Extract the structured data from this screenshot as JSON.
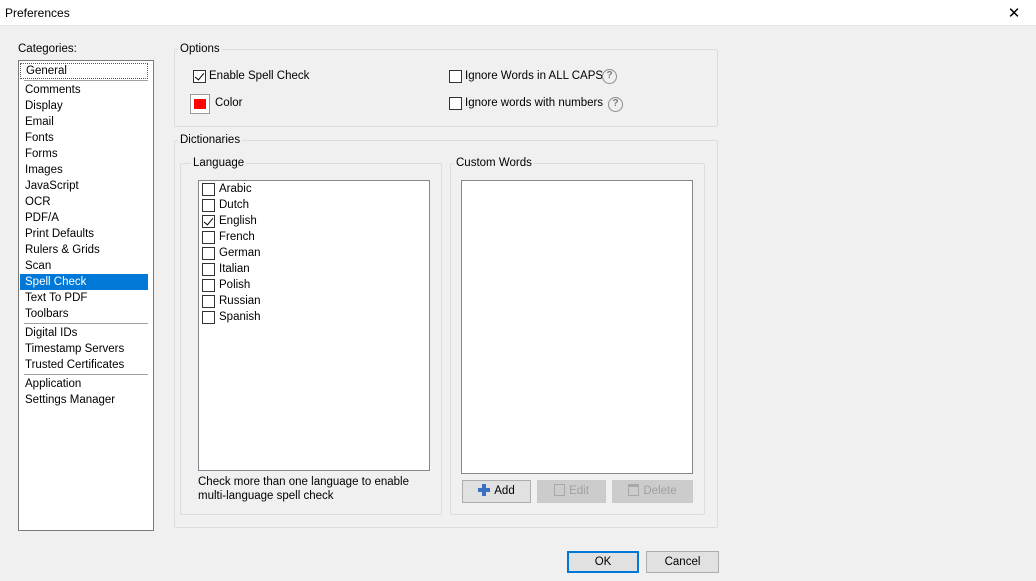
{
  "window": {
    "title": "Preferences",
    "close_glyph": "✕"
  },
  "categories": {
    "label": "Categories:",
    "groups": [
      [
        "General"
      ],
      [
        "Comments",
        "Display",
        "Email",
        "Fonts",
        "Forms",
        "Images",
        "JavaScript",
        "OCR",
        "PDF/A",
        "Print Defaults",
        "Rulers & Grids",
        "Scan",
        "Spell Check",
        "Text To PDF",
        "Toolbars"
      ],
      [
        "Digital IDs",
        "Timestamp Servers",
        "Trusted Certificates"
      ],
      [
        "Application",
        "Settings Manager"
      ]
    ],
    "selected": "Spell Check"
  },
  "options": {
    "label": "Options",
    "enable_spell_check": {
      "label": "Enable Spell Check",
      "checked": true
    },
    "color": {
      "label": "Color",
      "value": "#ff0000"
    },
    "ignore_caps": {
      "label": "Ignore Words in ALL CAPS",
      "checked": false
    },
    "ignore_numbers": {
      "label": "Ignore words with numbers",
      "checked": false
    },
    "help_glyph": "?"
  },
  "dictionaries": {
    "label": "Dictionaries",
    "language": {
      "label": "Language",
      "items": [
        {
          "name": "Arabic",
          "checked": false
        },
        {
          "name": "Dutch",
          "checked": false
        },
        {
          "name": "English",
          "checked": true
        },
        {
          "name": "French",
          "checked": false
        },
        {
          "name": "German",
          "checked": false
        },
        {
          "name": "Italian",
          "checked": false
        },
        {
          "name": "Polish",
          "checked": false
        },
        {
          "name": "Russian",
          "checked": false
        },
        {
          "name": "Spanish",
          "checked": false
        }
      ],
      "hint_line1": "Check more than one language to enable",
      "hint_line2": "multi-language spell check"
    },
    "custom_words": {
      "label": "Custom Words",
      "add_label": "Add",
      "edit_label": "Edit",
      "delete_label": "Delete"
    }
  },
  "footer": {
    "ok_label": "OK",
    "cancel_label": "Cancel"
  },
  "colors": {
    "selection": "#0078d7",
    "swatch": "#ff0000",
    "add_icon": "#3a6fc4"
  }
}
